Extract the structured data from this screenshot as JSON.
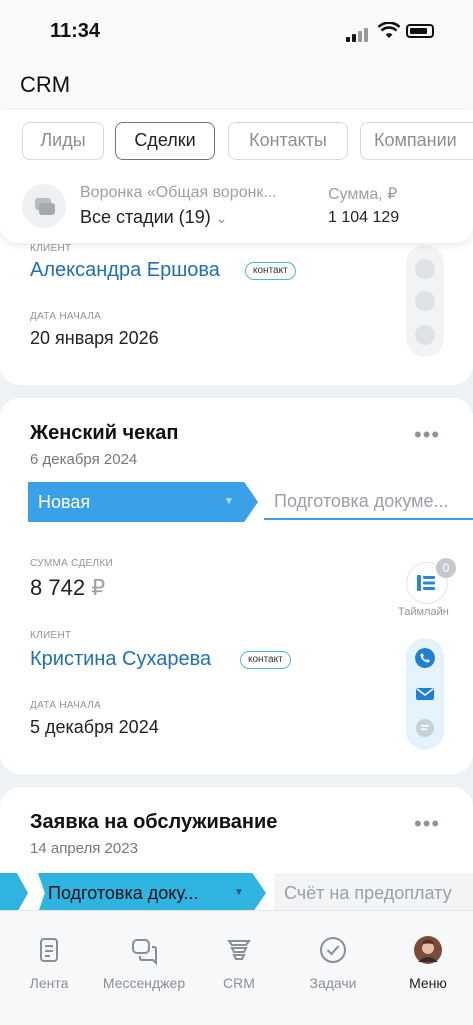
{
  "status_bar": {
    "time": "11:34"
  },
  "header": {
    "title": "CRM"
  },
  "tabs": [
    {
      "label": "Лиды"
    },
    {
      "label": "Сделки",
      "active": true
    },
    {
      "label": "Контакты"
    },
    {
      "label": "Компании"
    }
  ],
  "funnel": {
    "label": "Воронка «Общая воронк...",
    "value": "Все стадии (19)",
    "sum_label": "Сумма, ₽",
    "sum_value": "1 104 129"
  },
  "cards": [
    {
      "client_label": "КЛИЕНТ",
      "client_name": "Александра Ершова",
      "client_badge": "контакт",
      "start_label": "ДАТА НАЧАЛА",
      "start_date": "20 января 2026"
    },
    {
      "title": "Женский чекап",
      "date": "6 декабря 2024",
      "more": "•••",
      "stage": "Новая",
      "next_stage": "Подготовка докуме...",
      "amount_label": "СУММА СДЕЛКИ",
      "amount": "8 742",
      "currency": "₽",
      "timeline_count": "0",
      "timeline_label": "Таймлайн",
      "client_label": "КЛИЕНТ",
      "client_name": "Кристина Сухарева",
      "client_badge": "контакт",
      "start_label": "ДАТА НАЧАЛА",
      "start_date": "5 декабря 2024"
    },
    {
      "title": "Заявка на обслуживание",
      "date": "14 апреля 2023",
      "more": "•••",
      "stage": "Подготовка доку...",
      "next_stage": "Счёт на предоплату"
    }
  ],
  "tabbar": [
    {
      "label": "Лента",
      "icon": "feed-icon"
    },
    {
      "label": "Мессенджер",
      "icon": "messenger-icon"
    },
    {
      "label": "CRM",
      "icon": "crm-icon"
    },
    {
      "label": "Задачи",
      "icon": "tasks-icon"
    },
    {
      "label": "Меню",
      "icon": "avatar",
      "active": true
    }
  ],
  "colors": {
    "accent": "#3aa0e8",
    "link": "#1f6fb5",
    "badge_border": "#4cb8d5"
  }
}
